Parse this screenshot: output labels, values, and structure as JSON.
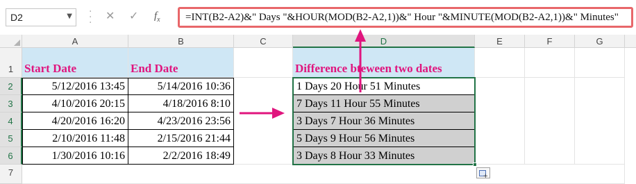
{
  "formula_bar": {
    "name_box": "D2",
    "formula": "=INT(B2-A2)&\" Days \"&HOUR(MOD(B2-A2,1))&\" Hour \"&MINUTE(MOD(B2-A2,1))&\" Minutes\""
  },
  "columns": [
    "A",
    "B",
    "C",
    "D",
    "E",
    "F",
    "G"
  ],
  "rows": [
    "1",
    "2",
    "3",
    "4",
    "5",
    "6",
    "7"
  ],
  "headers": {
    "start_date": "Start Date",
    "end_date": "End Date",
    "difference": "Difference bteween two dates"
  },
  "data_rows": [
    {
      "start": "5/12/2016 13:45",
      "end": "5/14/2016 10:36",
      "diff": "1 Days 20 Hour 51 Minutes"
    },
    {
      "start": "4/10/2016 20:15",
      "end": "4/18/2016 8:10",
      "diff": "7 Days 11 Hour 55 Minutes"
    },
    {
      "start": "4/20/2016 16:20",
      "end": "4/23/2016 23:56",
      "diff": "3 Days 7 Hour 36 Minutes"
    },
    {
      "start": "2/10/2016 11:48",
      "end": "2/15/2016 21:44",
      "diff": "5 Days 9 Hour 56 Minutes"
    },
    {
      "start": "1/30/2016 10:16",
      "end": "2/2/2016 18:49",
      "diff": "3 Days 8 Hour 33 Minutes"
    }
  ],
  "colors": {
    "accent_magenta": "#e0157e",
    "header_fill": "#cfe7f5",
    "selection_green": "#217346",
    "formula_highlight": "#e8676a"
  }
}
